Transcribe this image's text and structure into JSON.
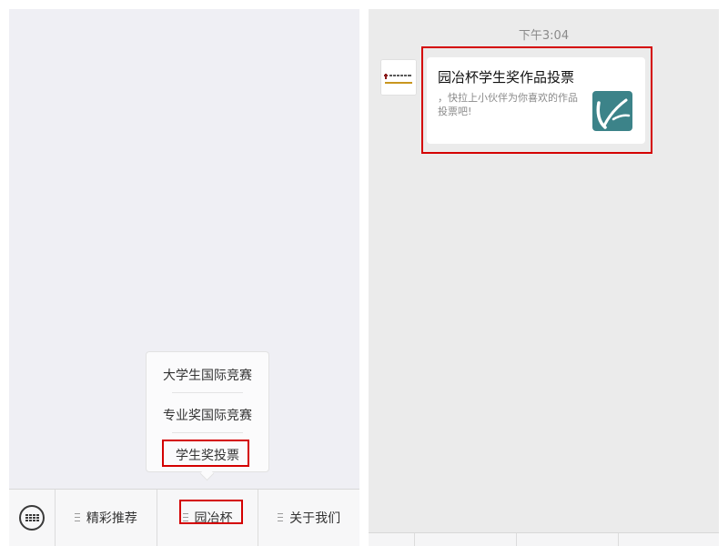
{
  "left": {
    "menu_popup": {
      "items": [
        {
          "label": "大学生国际竞赛"
        },
        {
          "label": "专业奖国际竞赛"
        },
        {
          "label": "学生奖投票"
        }
      ]
    },
    "bottom_menu": {
      "items": [
        {
          "label": "精彩推荐"
        },
        {
          "label": "园冶杯"
        },
        {
          "label": "关于我们"
        }
      ]
    },
    "icons": {
      "keyboard": "keyboard-icon",
      "menu": "menu-lines-icon"
    },
    "highlight_color": "#d40000"
  },
  "right": {
    "timestamp": "下午3:04",
    "message_card": {
      "title": "园冶杯学生奖作品投票",
      "description": "，快拉上小伙伴为你喜欢的作品投票吧!",
      "thumbnail_icon": "teal-logo-thumbnail",
      "thumbnail_color": "#3c8389"
    },
    "avatar_icon": "publisher-logo-avatar"
  }
}
